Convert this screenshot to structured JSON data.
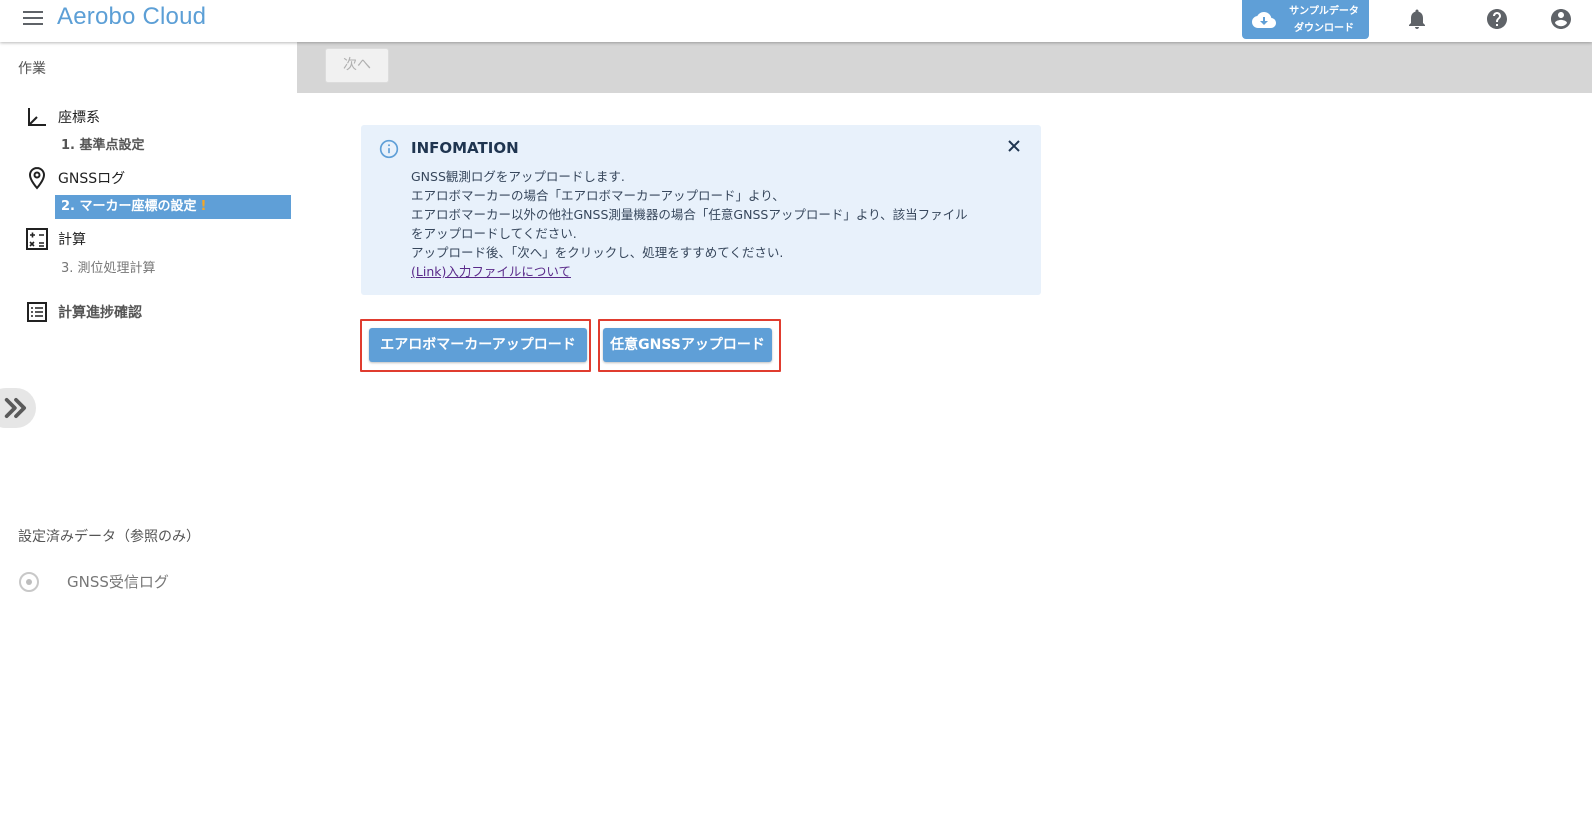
{
  "header": {
    "app_title": "Aerobo Cloud",
    "sample_download_label": "サンプルデータ\nダウンロード"
  },
  "sidebar": {
    "section_work": "作業",
    "items": [
      {
        "label": "座標系",
        "icon": "axis-icon"
      },
      {
        "label": "GNSSログ",
        "icon": "location-pin-icon"
      },
      {
        "label": "計算",
        "icon": "calculator-icon"
      },
      {
        "label": "計算進捗確認",
        "icon": "list-icon"
      }
    ],
    "sub_items": {
      "step1": "1. 基準点設定",
      "step2": "2. マーカー座標の設定",
      "step2_warning": "!",
      "step3": "3. 測位処理計算"
    },
    "section_reference": "設定済みデータ（参照のみ）",
    "reference_items": [
      {
        "label": "GNSS受信ログ"
      }
    ]
  },
  "toolbar": {
    "next_label": "次へ"
  },
  "info": {
    "title": "INFOMATION",
    "lines": [
      "GNSS観測ログをアップロードします.",
      "エアロボマーカーの場合「エアロボマーカーアップロード」より、",
      "エアロボマーカー以外の他社GNSS測量機器の場合「任意GNSSアップロード」より、該当ファイル",
      "をアップロードしてください.",
      "アップロード後、「次へ」をクリックし、処理をすすめてください."
    ],
    "link": "(Link)入力ファイルについて"
  },
  "actions": {
    "aerobo_upload": "エアロボマーカーアップロード",
    "gnss_upload": "任意GNSSアップロード"
  },
  "colors": {
    "accent": "#5f9fd7",
    "highlight_outline": "#e03c2f",
    "info_bg": "#e8f1fb"
  }
}
